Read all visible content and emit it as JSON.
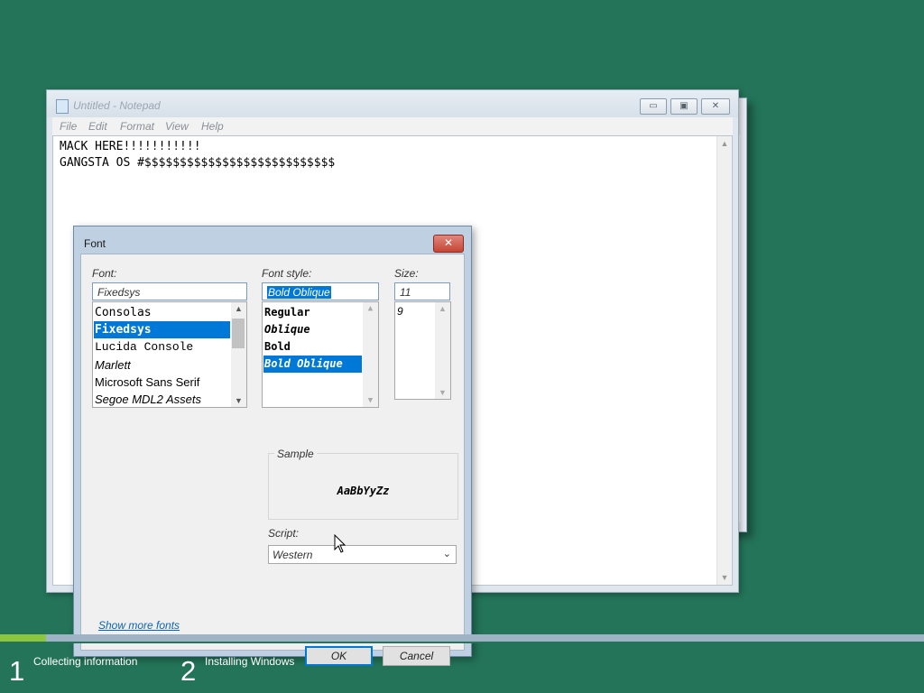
{
  "notepad": {
    "title": "Untitled - Notepad",
    "menu": [
      "File",
      "Edit",
      "Format",
      "View",
      "Help"
    ],
    "content_lines": [
      "MACK HERE!!!!!!!!!!!",
      "GANGSTA OS #$$$$$$$$$$$$$$$$$$$$$$$$$$$"
    ],
    "caption_buttons": {
      "minimize": "▭",
      "maximize": "▣",
      "close": "✕"
    }
  },
  "font_dialog": {
    "title": "Font",
    "close_glyph": "✕",
    "font_label": "Font:",
    "font_value": "Fixedsys",
    "font_list": [
      "Consolas",
      "Fixedsys",
      "Lucida Console",
      "Marlett",
      "Microsoft Sans Serif",
      "Segoe MDL2 Assets"
    ],
    "font_selected": "Fixedsys",
    "style_label": "Font style:",
    "style_value": "Bold Oblique",
    "style_list": [
      "Regular",
      "Oblique",
      "Bold",
      "Bold Oblique"
    ],
    "style_selected": "Bold Oblique",
    "size_label": "Size:",
    "size_value": "11",
    "size_list": [
      "9"
    ],
    "sample_label": "Sample",
    "sample_text": "AaBbYyZz",
    "script_label": "Script:",
    "script_value": "Western",
    "show_more_fonts": "Show more fonts",
    "ok_label": "OK",
    "cancel_label": "Cancel"
  },
  "setup": {
    "progress_percent": 5,
    "steps": [
      {
        "number": "1",
        "label": "Collecting information"
      },
      {
        "number": "2",
        "label": "Installing Windows"
      }
    ]
  },
  "colors": {
    "desktop": "#237458",
    "accent": "#0078d7",
    "progress": "#8cc63f"
  }
}
